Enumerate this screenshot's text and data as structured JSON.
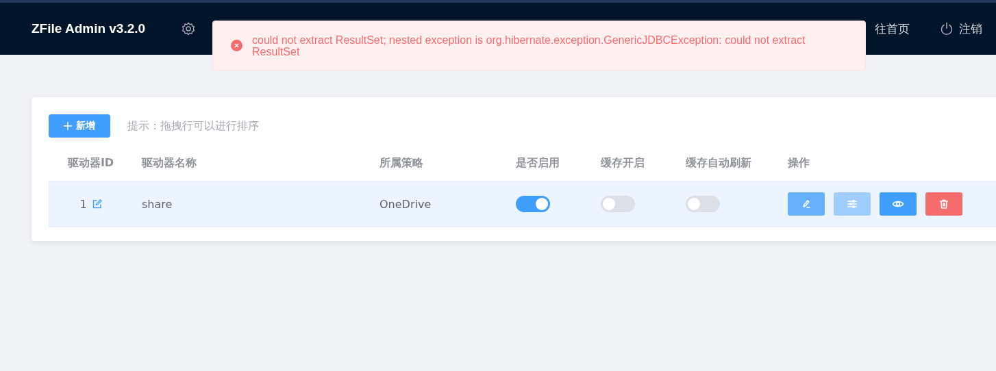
{
  "header": {
    "title": "ZFile Admin v3.2.0",
    "nav": [
      {
        "kind": "settings"
      },
      {
        "kind": "home",
        "label": "往首页"
      },
      {
        "kind": "logout",
        "label": "注销"
      }
    ]
  },
  "toast": {
    "message": "could not extract ResultSet; nested exception is org.hibernate.exception.GenericJDBCException: could not extract ResultSet"
  },
  "toolbar": {
    "add_button": "新增",
    "hint": "提示：拖拽行可以进行排序"
  },
  "table": {
    "columns": [
      "驱动器ID",
      "驱动器名称",
      "所属策略",
      "是否启用",
      "缓存开启",
      "缓存自动刷新",
      "操作"
    ],
    "rows": [
      {
        "id": "1",
        "name": "share",
        "policy": "OneDrive",
        "enabled": true,
        "cache_enabled": false,
        "auto_refresh": false,
        "selected": true
      }
    ]
  }
}
